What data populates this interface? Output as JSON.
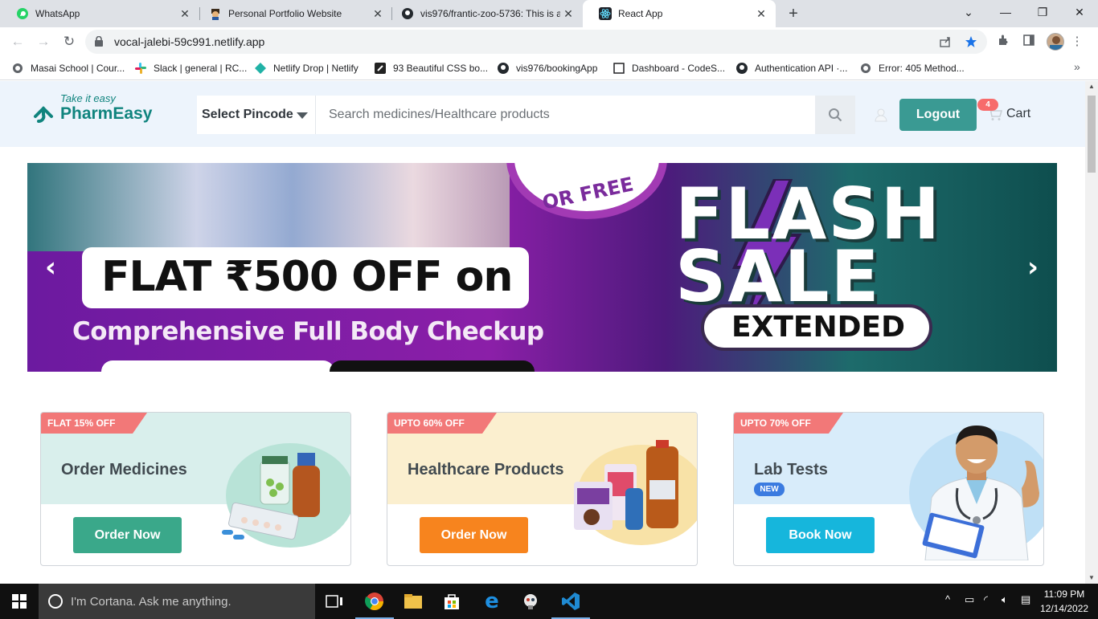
{
  "browser": {
    "tabs": [
      {
        "title": "WhatsApp",
        "icon": "whatsapp-icon",
        "active": false
      },
      {
        "title": "Personal Portfolio Website",
        "icon": "portfolio-icon",
        "active": false
      },
      {
        "title": "vis976/frantic-zoo-5736: This is a",
        "icon": "github-icon",
        "active": false
      },
      {
        "title": "React App",
        "icon": "react-icon",
        "active": true
      }
    ],
    "url": "vocal-jalebi-59c991.netlify.app",
    "bookmarks": [
      {
        "label": "Masai School | Cour...",
        "icon": "globe-icon"
      },
      {
        "label": "Slack | general | RC...",
        "icon": "slack-icon"
      },
      {
        "label": "Netlify Drop | Netlify",
        "icon": "netlify-icon"
      },
      {
        "label": "93 Beautiful CSS bo...",
        "icon": "css-icon"
      },
      {
        "label": "vis976/bookingApp",
        "icon": "github-icon"
      },
      {
        "label": "Dashboard - CodeS...",
        "icon": "page-icon"
      },
      {
        "label": "Authentication API ·...",
        "icon": "github-icon"
      },
      {
        "label": "Error: 405 Method...",
        "icon": "globe-icon"
      }
    ]
  },
  "header": {
    "tagline": "Take it easy",
    "brand": "PharmEasy",
    "pincode_label": "Select Pincode",
    "search_placeholder": "Search medicines/Healthcare products",
    "logout_label": "Logout",
    "cart_label": "Cart",
    "cart_count": "4"
  },
  "banner": {
    "headline": "FLAT ₹500 OFF on",
    "subline": "Comprehensive Full Body Checkup",
    "badge_text": "OR FREE",
    "flash_line1": "FLASH",
    "flash_line2": "SALE",
    "extended": "EXTENDED"
  },
  "cards": [
    {
      "offer": "FLAT 15% OFF",
      "title": "Order Medicines",
      "button": "Order Now",
      "color": "#3aa88a",
      "bg": "#d9efec"
    },
    {
      "offer": "UPTO 60% OFF",
      "title": "Healthcare Products",
      "button": "Order Now",
      "color": "#f7841e",
      "bg": "#fbefcf"
    },
    {
      "offer": "UPTO 70% OFF",
      "title": "Lab Tests",
      "badge": "NEW",
      "button": "Book Now",
      "color": "#16b6dc",
      "bg": "#d8ecfa"
    }
  ],
  "taskbar": {
    "cortana_text": "I'm Cortana. Ask me anything.",
    "time": "11:09 PM",
    "date": "12/14/2022"
  }
}
